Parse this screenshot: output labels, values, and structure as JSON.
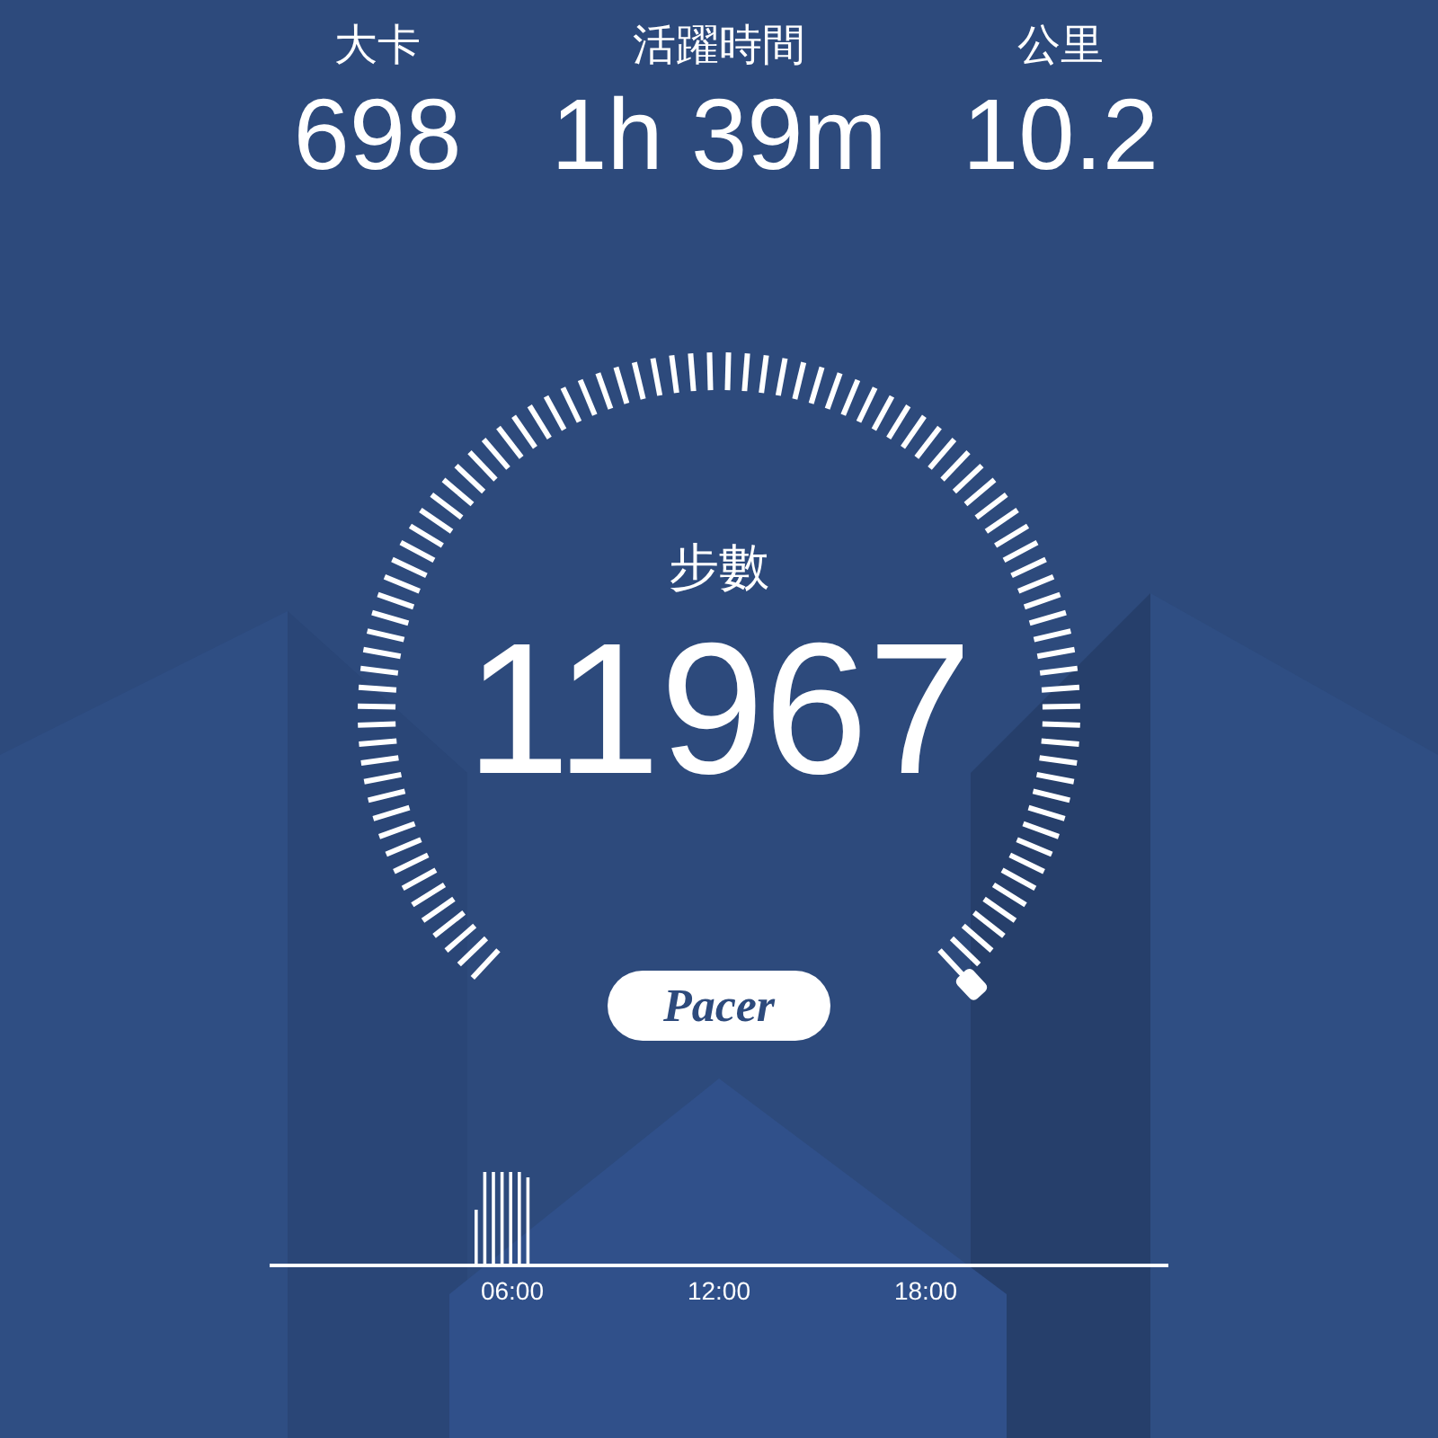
{
  "stats": [
    {
      "label": "大卡",
      "value": "698"
    },
    {
      "label": "活躍時間",
      "value": "1h 39m"
    },
    {
      "label": "公里",
      "value": "10.2"
    }
  ],
  "gauge": {
    "label": "步數",
    "value": "11967"
  },
  "logo": "Pacer",
  "chart": {
    "axis_labels": [
      "06:00",
      "12:00",
      "18:00"
    ]
  }
}
